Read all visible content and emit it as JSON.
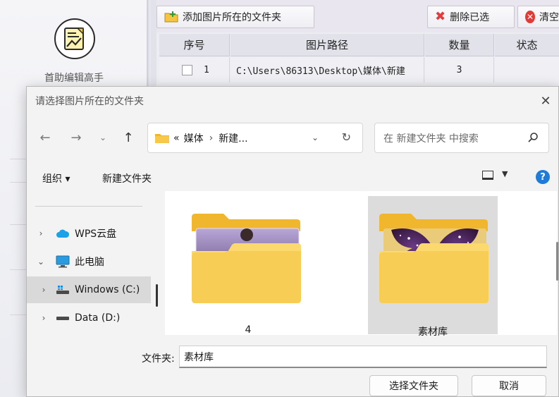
{
  "app": {
    "name": "首助编辑高手",
    "toolbar": {
      "add_folder": "添加图片所在的文件夹",
      "delete_selected": "删除已选",
      "clear": "清空"
    },
    "table": {
      "headers": [
        "序号",
        "图片路径",
        "数量",
        "状态"
      ],
      "rows": [
        {
          "index": "1",
          "path": "C:\\Users\\86313\\Desktop\\媒体\\新建",
          "count": "3",
          "status": ""
        }
      ]
    }
  },
  "dialog": {
    "title": "请选择图片所在的文件夹",
    "address": {
      "prefix": "«",
      "crumbs": [
        "媒体",
        "新建..."
      ]
    },
    "search_placeholder": "在 新建文件夹 中搜索",
    "commands": {
      "organize": "组织 ▾",
      "new_folder": "新建文件夹"
    },
    "tree": [
      {
        "label": "WPS云盘",
        "expanded": false,
        "icon": "cloud-icon"
      },
      {
        "label": "此电脑",
        "expanded": true,
        "icon": "computer-icon"
      },
      {
        "label": "Windows (C:)",
        "expanded": false,
        "icon": "windows-drive-icon",
        "selected": true
      },
      {
        "label": "Data (D:)",
        "expanded": false,
        "icon": "drive-icon"
      }
    ],
    "folders": [
      {
        "label": "4",
        "selected": false,
        "thumbnail": "girl-photo"
      },
      {
        "label": "素材库",
        "selected": true,
        "thumbnail": "butterfly-photo"
      }
    ],
    "folder_field_label": "文件夹:",
    "folder_field_value": "素材库",
    "ok_label": "选择文件夹",
    "cancel_label": "取消",
    "colors": {
      "accent": "#1e7bd8",
      "folder": "#f8c84a",
      "folder_back": "#f0b62e"
    }
  }
}
